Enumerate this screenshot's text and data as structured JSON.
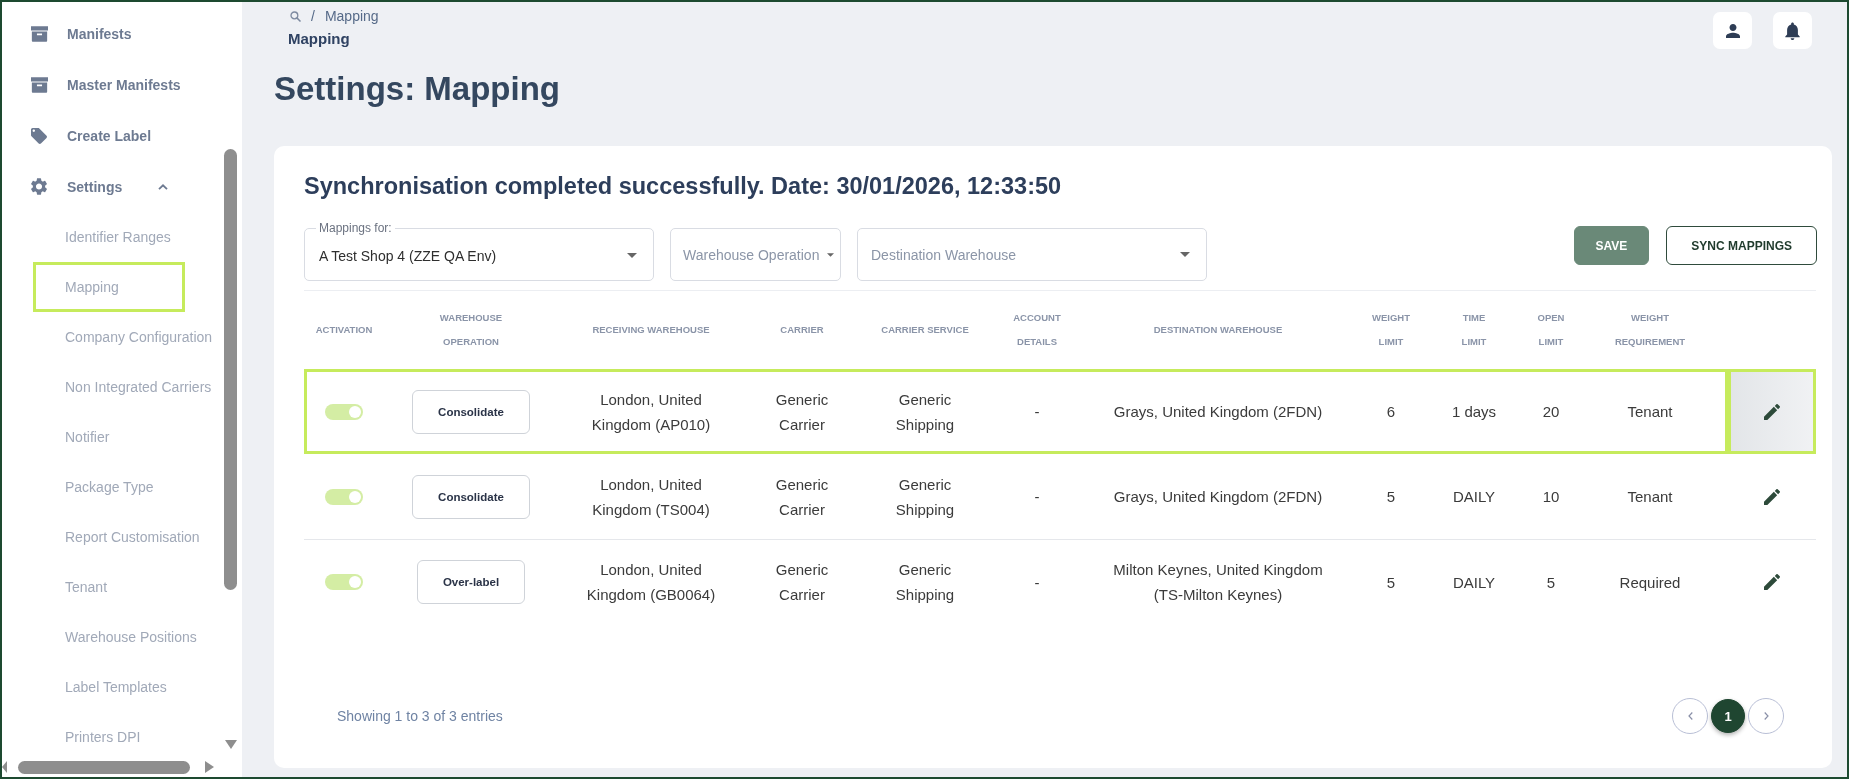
{
  "sidebar": {
    "items": [
      {
        "kind": "link",
        "label": "Manifests"
      },
      {
        "kind": "link",
        "label": "Master Manifests"
      },
      {
        "kind": "link",
        "label": "Create Label"
      },
      {
        "kind": "group",
        "label": "Settings",
        "expanded": true,
        "children": [
          {
            "label": "Identifier Ranges",
            "selected": false
          },
          {
            "label": "Mapping",
            "selected": true
          },
          {
            "label": "Company Configuration",
            "selected": false
          },
          {
            "label": "Non Integrated Carriers",
            "selected": false
          },
          {
            "label": "Notifier",
            "selected": false
          },
          {
            "label": "Package Type",
            "selected": false
          },
          {
            "label": "Report Customisation",
            "selected": false
          },
          {
            "label": "Tenant",
            "selected": false
          },
          {
            "label": "Warehouse Positions",
            "selected": false
          },
          {
            "label": "Label Templates",
            "selected": false
          },
          {
            "label": "Printers DPI",
            "selected": false
          }
        ]
      }
    ]
  },
  "breadcrumb": {
    "separator": "/",
    "items": [
      {
        "label": "Mapping"
      }
    ]
  },
  "page_name": "Mapping",
  "page_title": "Settings: Mapping",
  "card": {
    "status_message": "Synchronisation completed successfully. Date: 30/01/2026, 12:33:50",
    "filters": [
      {
        "kind": "select",
        "label": "Mappings for:",
        "value": "A Test Shop 4 (ZZE QA Env)"
      },
      {
        "kind": "menu",
        "placeholder": "Warehouse Operation"
      },
      {
        "kind": "select",
        "placeholder": "Destination Warehouse"
      }
    ],
    "buttons": [
      {
        "kind": "filled",
        "label": "SAVE"
      },
      {
        "kind": "outlined",
        "label": "SYNC MAPPINGS"
      }
    ],
    "table": {
      "columns": [
        "ACTIVATION",
        "WAREHOUSE OPERATION",
        "RECEIVING WAREHOUSE",
        "CARRIER",
        "CARRIER SERVICE",
        "ACCOUNT DETAILS",
        "DESTINATION WAREHOUSE",
        "WEIGHT LIMIT",
        "TIME LIMIT",
        "OPEN LIMIT",
        "WEIGHT REQUIREMENT"
      ],
      "rows": [
        {
          "active": true,
          "highlighted": true,
          "edit_hovered": true,
          "warehouse_operation": "Consolidate",
          "receiving_warehouse": "London, United Kingdom (AP010)",
          "carrier": "Generic Carrier",
          "carrier_service": "Generic Shipping",
          "account_details": "-",
          "destination_warehouse": "Grays, United Kingdom (2FDN)",
          "weight_limit": "6",
          "time_limit": "1 days",
          "open_limit": "20",
          "weight_requirement": "Tenant"
        },
        {
          "active": true,
          "highlighted": false,
          "edit_hovered": false,
          "warehouse_operation": "Consolidate",
          "receiving_warehouse": "London, United Kingdom (TS004)",
          "carrier": "Generic Carrier",
          "carrier_service": "Generic Shipping",
          "account_details": "-",
          "destination_warehouse": "Grays, United Kingdom (2FDN)",
          "weight_limit": "5",
          "time_limit": "DAILY",
          "open_limit": "10",
          "weight_requirement": "Tenant"
        },
        {
          "active": true,
          "highlighted": false,
          "edit_hovered": false,
          "warehouse_operation": "Over-label",
          "receiving_warehouse": "London, United Kingdom (GB0064)",
          "carrier": "Generic Carrier",
          "carrier_service": "Generic Shipping",
          "account_details": "-",
          "destination_warehouse": "Milton Keynes, United Kingdom (TS-Milton Keynes)",
          "weight_limit": "5",
          "time_limit": "DAILY",
          "open_limit": "5",
          "weight_requirement": "Required"
        }
      ]
    },
    "entries_info": "Showing 1 to 3 of 3 entries",
    "pagination": {
      "pages": [
        {
          "label": "1",
          "selected": true
        }
      ]
    }
  }
}
